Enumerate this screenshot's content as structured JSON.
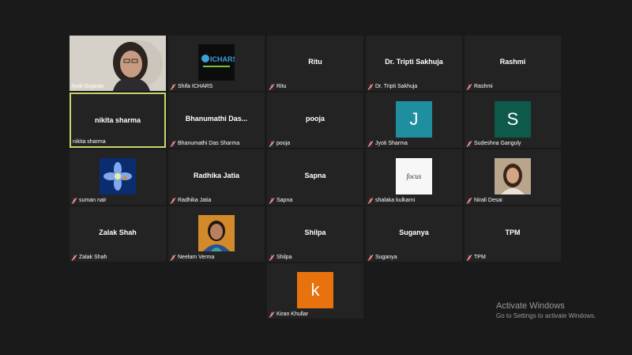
{
  "participants": [
    {
      "name": "Jyoti Gujaran",
      "kind": "video"
    },
    {
      "name": "Shifa ICHARS",
      "kind": "logo",
      "logo_text": "ICHARS"
    },
    {
      "name": "Ritu",
      "kind": "name",
      "display": "Ritu"
    },
    {
      "name": "Dr. Tripti Sakhuja",
      "kind": "name",
      "display": "Dr. Tripti Sakhuja"
    },
    {
      "name": "Rashmi",
      "kind": "name",
      "display": "Rashmi"
    },
    {
      "name": "nikita sharma",
      "kind": "name",
      "display": "nikita sharma",
      "active": true
    },
    {
      "name": "Bhanumathi Das Sharma",
      "kind": "name",
      "display": "Bhanumathi  Das..."
    },
    {
      "name": "pooja",
      "kind": "name",
      "display": "pooja"
    },
    {
      "name": "Jyoti Sharma",
      "kind": "letter",
      "letter": "J",
      "color": "#1f8fa0"
    },
    {
      "name": "Sudeshna Ganguly",
      "kind": "letter",
      "letter": "S",
      "color": "#0d5a4b"
    },
    {
      "name": "suman nair",
      "kind": "flower"
    },
    {
      "name": "Radhika Jatia",
      "kind": "name",
      "display": "Radhika Jatia"
    },
    {
      "name": "Sapna",
      "kind": "name",
      "display": "Sapna"
    },
    {
      "name": "shalaka kulkarni",
      "kind": "focus",
      "focus_text": "focus"
    },
    {
      "name": "Nirali Desai",
      "kind": "photo-girl"
    },
    {
      "name": "Zalak Shah",
      "kind": "name",
      "display": "Zalak Shah"
    },
    {
      "name": "Neelam Verma",
      "kind": "photo-woman"
    },
    {
      "name": "Shilpa",
      "kind": "name",
      "display": "Shilpa"
    },
    {
      "name": "Suganya",
      "kind": "name",
      "display": "Suganya"
    },
    {
      "name": "TPM",
      "kind": "name",
      "display": "TPM"
    },
    {
      "name": "Kiran Khullar",
      "kind": "letter",
      "letter": "k",
      "color": "#e8730e"
    }
  ],
  "watermark": {
    "title": "Activate Windows",
    "subtitle": "Go to Settings to activate Windows."
  },
  "colors": {
    "background": "#1a1a1a",
    "tile": "#232323",
    "active_border": "#c8d66a",
    "muted_mic": "#e03a3a"
  }
}
